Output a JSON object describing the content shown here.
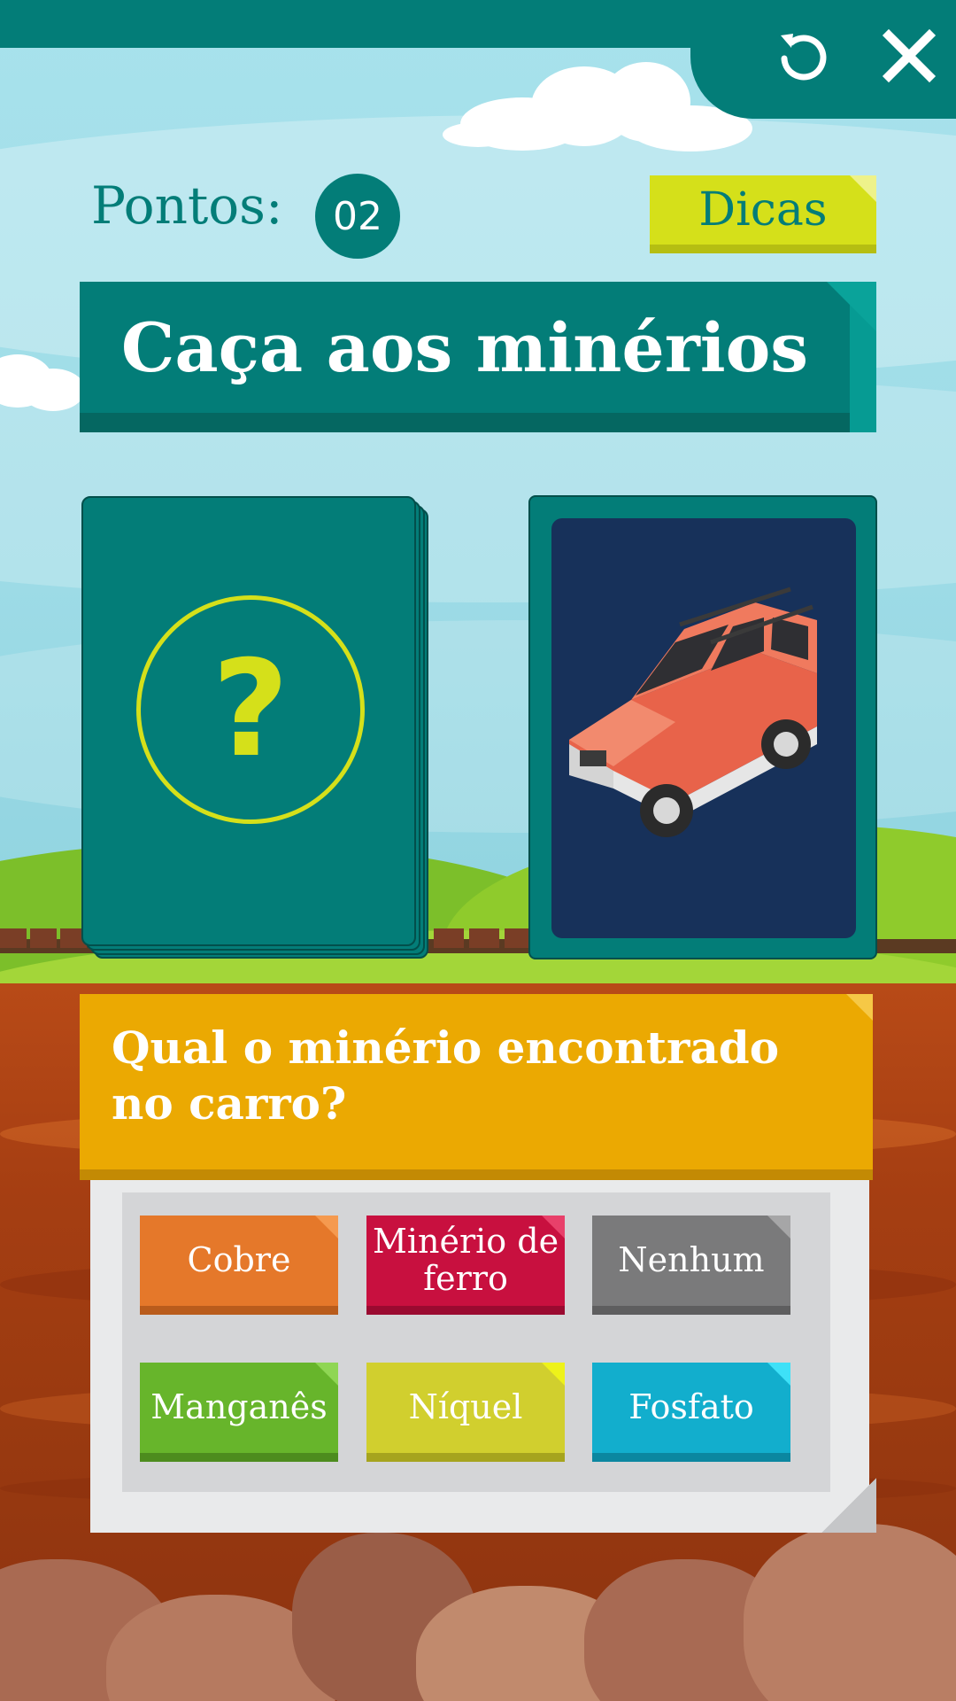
{
  "header": {
    "reset_icon": "reset-icon",
    "close_icon": "close-icon"
  },
  "score": {
    "label": "Pontos:",
    "value": "02"
  },
  "hints_button": {
    "label": "Dicas"
  },
  "title": "Caça aos minérios",
  "deck": {
    "symbol": "?"
  },
  "card": {
    "image": "orange-suv-car"
  },
  "question": "Qual o minério encontrado no carro?",
  "answers": [
    {
      "label": "Cobre",
      "color": "#e5782a"
    },
    {
      "label": "Minério de ferro",
      "color": "#c8103f"
    },
    {
      "label": "Nenhum",
      "color": "#7a7a7b"
    },
    {
      "label": "Manganês",
      "color": "#67b52b"
    },
    {
      "label": "Níquel",
      "color": "#d1cf2e"
    },
    {
      "label": "Fosfato",
      "color": "#12aecd"
    }
  ],
  "colors": {
    "teal": "#037d78",
    "yellow": "#d5e01a",
    "orange": "#eba902"
  }
}
